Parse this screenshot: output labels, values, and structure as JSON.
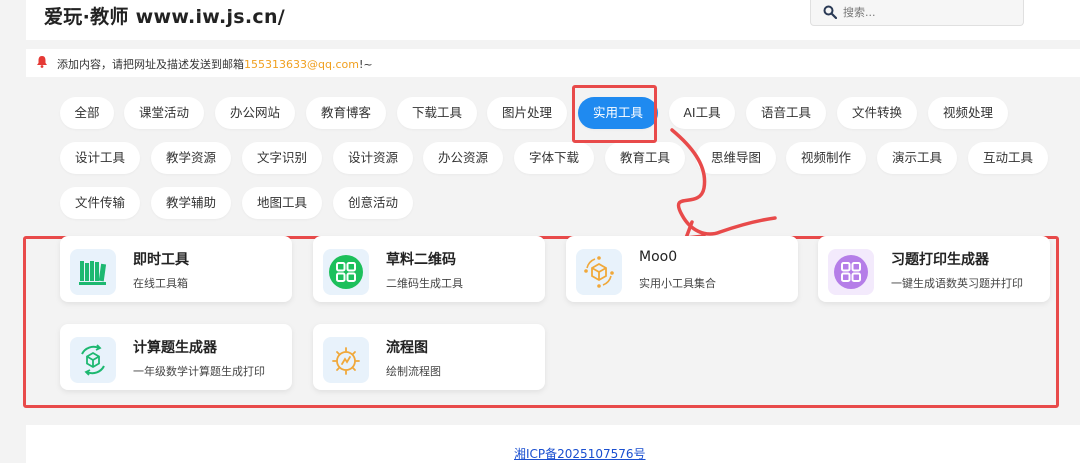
{
  "header": {
    "site_title": "爱玩·教师 www.iw.js.cn/",
    "search_placeholder": "搜索..."
  },
  "notice": {
    "text_before": "添加内容，请把网址及描述发送到邮箱",
    "email": "155313633@qq.com",
    "text_after": "!~"
  },
  "categories": {
    "row1": [
      "全部",
      "课堂活动",
      "办公网站",
      "教育博客",
      "下载工具",
      "图片处理",
      "实用工具",
      "AI工具",
      "语音工具",
      "文件转换",
      "视频处理"
    ],
    "row2": [
      "设计工具",
      "教学资源",
      "文字识别",
      "设计资源",
      "办公资源",
      "字体下载",
      "教育工具",
      "思维导图",
      "视频制作",
      "演示工具",
      "互动工具"
    ],
    "row3": [
      "文件传输",
      "教学辅助",
      "地图工具",
      "创意活动"
    ],
    "active": "实用工具"
  },
  "tools": [
    {
      "title": "即时工具",
      "desc": "在线工具箱",
      "icon": "bookshelf-icon"
    },
    {
      "title": "草料二维码",
      "desc": "二维码生成工具",
      "icon": "qr-grid-icon"
    },
    {
      "title": "Moo0",
      "desc": "实用小工具集合",
      "icon": "cube-cycle-icon"
    },
    {
      "title": "习题打印生成器",
      "desc": "一键生成语数英习题并打印",
      "icon": "grid-apps-icon"
    },
    {
      "title": "计算题生成器",
      "desc": "一年级数学计算题生成打印",
      "icon": "cube-recycle-icon"
    },
    {
      "title": "流程图",
      "desc": "绘制流程图",
      "icon": "flow-gear-icon"
    }
  ],
  "footer": {
    "icp": "湘ICP备2025107576号"
  },
  "colors": {
    "accent": "#1f8af0",
    "highlight": "#e84a4a",
    "email": "#f0a020",
    "link": "#1a4fd0"
  }
}
